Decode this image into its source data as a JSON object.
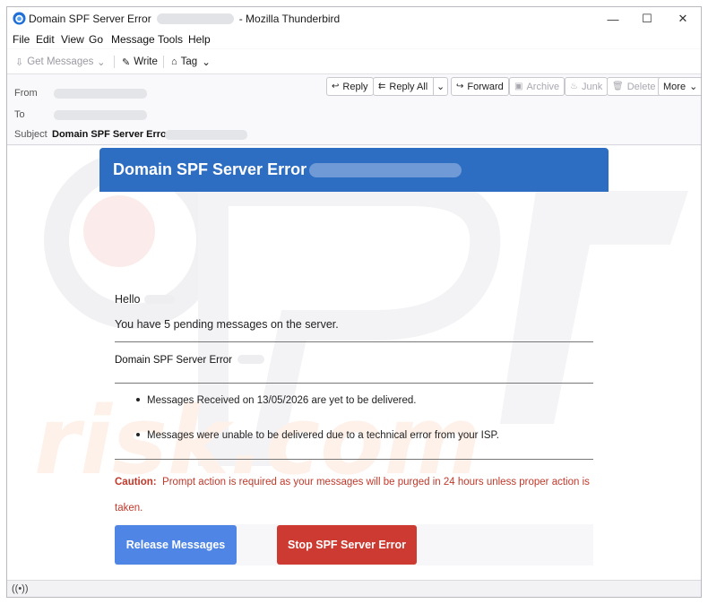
{
  "window": {
    "title_prefix": "Domain SPF Server Error",
    "title_suffix": "- Mozilla Thunderbird",
    "controls": {
      "minimize": "—",
      "maximize": "☐",
      "close": "✕"
    }
  },
  "menu": [
    "File",
    "Edit",
    "View",
    "Go",
    "Message",
    "Tools",
    "Help"
  ],
  "toolbar": {
    "get_messages": "Get Messages",
    "write": "Write",
    "tag": "Tag"
  },
  "header": {
    "from_label": "From",
    "to_label": "To",
    "subject_label": "Subject",
    "subject": "Domain SPF Server Error",
    "buttons": {
      "reply": "Reply",
      "reply_all": "Reply All",
      "forward": "Forward",
      "archive": "Archive",
      "junk": "Junk",
      "delete": "Delete",
      "more": "More"
    }
  },
  "email": {
    "banner_title": "Domain SPF Server Error",
    "greeting": "Hello",
    "pending": "You have 5 pending messages on the server.",
    "error_heading": "Domain SPF Server Error",
    "bullets": [
      "Messages Received on 13/05/2026 are yet to be delivered.",
      "Messages were unable to be delivered due to a technical error from your ISP."
    ],
    "caution_label": "Caution:",
    "caution_text": "Prompt action is required as your messages will be purged in 24 hours unless proper action is taken.",
    "release_button": "Release Messages",
    "stop_button": "Stop SPF Server Error"
  },
  "colors": {
    "banner": "#2d6dc2",
    "release": "#4f86e6",
    "stop": "#cc3a32",
    "caution": "#c0392b"
  },
  "icons": {
    "app": "thunderbird-icon",
    "status": "activity-icon"
  }
}
